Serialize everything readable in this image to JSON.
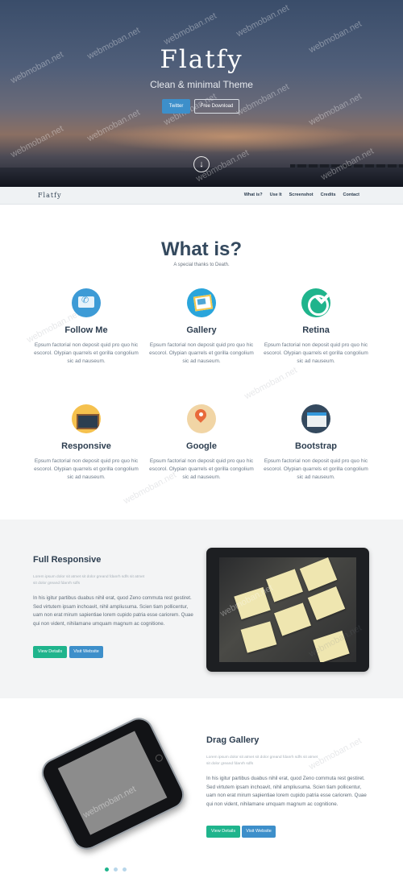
{
  "hero": {
    "brand": "Flatfy",
    "tagline": "Clean & minimal Theme",
    "twitter_button": "Twitter",
    "download_button": "Free Download",
    "scroll_icon": "arrow-down-circle-icon"
  },
  "navbar": {
    "brand": "Flatfy",
    "links": [
      "What is?",
      "Use It",
      "Screenshot",
      "Credits",
      "Contact"
    ]
  },
  "what_is": {
    "title": "What is?",
    "subtitle": "A special thanks to Death.",
    "features": [
      {
        "title": "Follow Me",
        "icon": "twitter-icon",
        "text": "Epsum factorial non deposit quid pro quo hic escorol. Olypian quarrels et gorilla congolium sic ad nauseum."
      },
      {
        "title": "Gallery",
        "icon": "gallery-icon",
        "text": "Epsum factorial non deposit quid pro quo hic escorol. Olypian quarrels et gorilla congolium sic ad nauseum."
      },
      {
        "title": "Retina",
        "icon": "retina-check-icon",
        "text": "Epsum factorial non deposit quid pro quo hic escorol. Olypian quarrels et gorilla congolium sic ad nauseum."
      },
      {
        "title": "Responsive",
        "icon": "responsive-screen-icon",
        "text": "Epsum factorial non deposit quid pro quo hic escorol. Olypian quarrels et gorilla congolium sic ad nauseum."
      },
      {
        "title": "Google",
        "icon": "map-pin-icon",
        "text": "Epsum factorial non deposit quid pro quo hic escorol. Olypian quarrels et gorilla congolium sic ad nauseum."
      },
      {
        "title": "Bootstrap",
        "icon": "browser-window-icon",
        "text": "Epsum factorial non deposit quid pro quo hic escorol. Olypian quarrels et gorilla congolium sic ad nauseum."
      }
    ]
  },
  "full_responsive": {
    "title": "Full Responsive",
    "meta": "Lorem ipsum dolor sit atmet sit dolor greand fdanrh sdfs sit atmet sit dolor greand fdanrh sdfs",
    "text": "In his igitur partibus duabus nihil erat, quod Zeno commuta rest gestiret. Sed virtutem ipsam inchoavit, nihil ampliusuma. Scien tiam pollicentur, uam non erat mirum sapientiae lorem cupido patria esse cariorem. Quae qui non vident, nihilamane umquam magnum ac cognitione.",
    "details_button": "View Details",
    "website_button": "Visit Website"
  },
  "drag_gallery": {
    "title": "Drag Gallery",
    "meta": "Lorem ipsum dolor sit atmet sit dolor greand fdanrh sdfs sit atmet sit dolor greand fdanrh sdfs",
    "text": "In his igitur partibus duabus nihil erat, quod Zeno commuta rest gestiret. Sed virtutem ipsam inchoavit, nihil ampliusuma. Scien tiam pollicentur, uam non erat mirum sapientiae lorem cupido patria esse cariorem. Quae qui non vident, nihilamane umquam magnum ac cognitione.",
    "details_button": "View Details",
    "website_button": "Visit Website"
  },
  "watermark": "webmoban.net",
  "colors": {
    "accent_green": "#1fb48c",
    "accent_blue": "#3d8fca",
    "heading": "#2d3e50"
  }
}
